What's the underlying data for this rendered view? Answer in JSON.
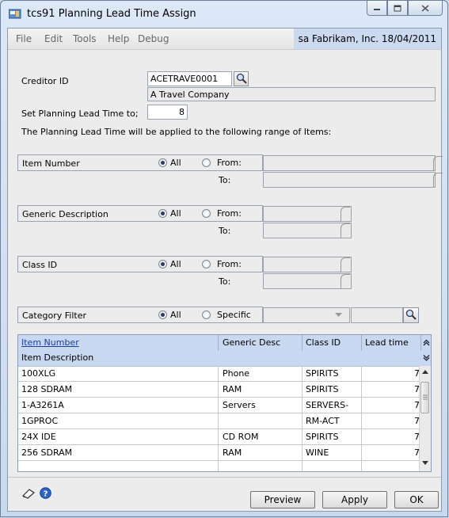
{
  "window": {
    "title": "tcs91 Planning Lead Time Assign",
    "controls": [
      "minimize-icon",
      "maximize-icon",
      "close-icon"
    ]
  },
  "menu": {
    "items": [
      "File",
      "Edit",
      "Tools",
      "Help",
      "Debug"
    ],
    "user_info": "sa  Fabrikam, Inc.  18/04/2011"
  },
  "form": {
    "creditor_id_label": "Creditor ID",
    "creditor_id_value": "ACETRAVE0001",
    "creditor_name": "A Travel Company",
    "lead_time_label": "Set Planning Lead Time to;",
    "lead_time_value": "8",
    "range_note": "The  Planning Lead Time will be applied to the following range of Items:"
  },
  "ranges": [
    {
      "label": "Item Number",
      "all": "All",
      "from": "From:",
      "to": "To:"
    },
    {
      "label": "Generic Description",
      "all": "All",
      "from": "From:",
      "to": "To:"
    },
    {
      "label": "Class  ID",
      "all": "All",
      "from": "From:",
      "to": "To:"
    }
  ],
  "category": {
    "label": "Category Filter",
    "all": "All",
    "specific": "Specific"
  },
  "grid": {
    "headers": [
      "Item Number",
      "Generic Desc",
      "Class ID",
      "Lead time"
    ],
    "subheader": "Item Description",
    "rows": [
      [
        "100XLG",
        "Phone",
        "SPIRITS",
        "7"
      ],
      [
        "128 SDRAM",
        "RAM",
        "SPIRITS",
        "7"
      ],
      [
        "1-A3261A",
        "Servers",
        "SERVERS-",
        "7"
      ],
      [
        "1GPROC",
        "",
        "RM-ACT",
        "7"
      ],
      [
        "24X IDE",
        "CD ROM",
        "SPIRITS",
        "7"
      ],
      [
        "256 SDRAM",
        "RAM",
        "WINE",
        "7"
      ]
    ]
  },
  "buttons": {
    "preview": "Preview",
    "apply": "Apply",
    "ok": "OK"
  },
  "colors": {
    "accent": "#c7d8f0",
    "link": "#1a3f9e"
  }
}
